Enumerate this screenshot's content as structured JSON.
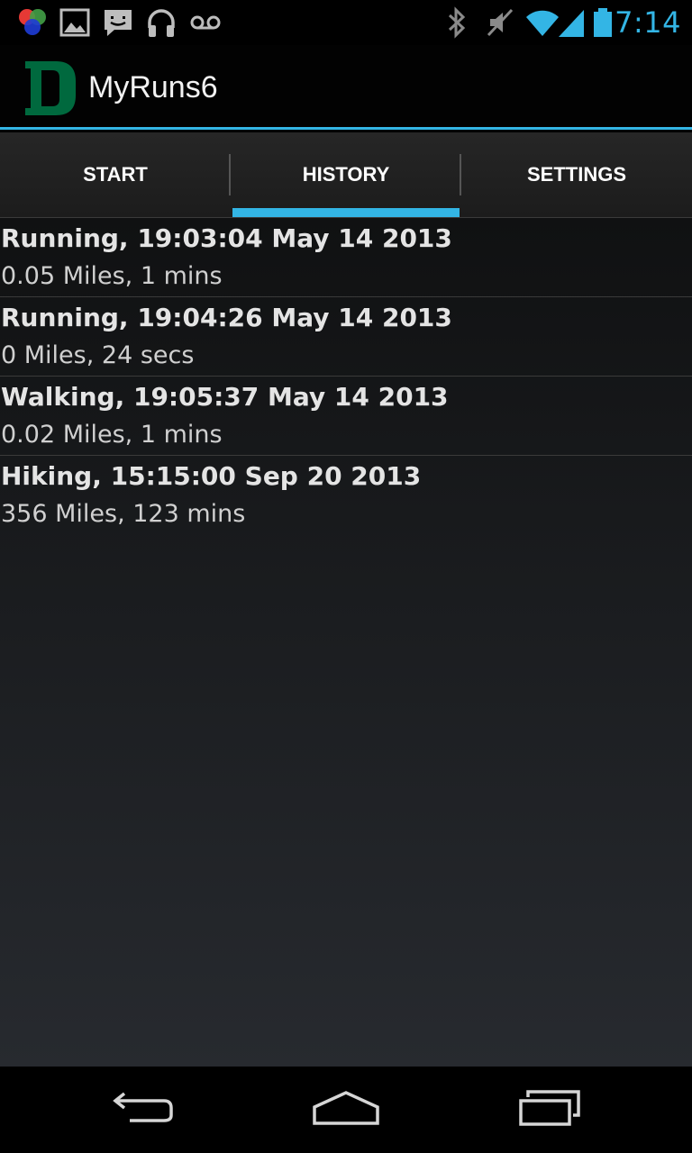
{
  "status_bar": {
    "time": "7:14",
    "accent_color": "#33b5e5",
    "left_icons": [
      "color-circles-icon",
      "gallery-icon",
      "message-icon",
      "headphones-icon",
      "voicemail-icon"
    ],
    "right_icons": [
      "bluetooth-icon",
      "vibrate-off-icon",
      "wifi-icon",
      "signal-icon",
      "battery-icon"
    ]
  },
  "action_bar": {
    "title": "MyRuns6",
    "logo_letter": "D",
    "logo_color": "#00693e"
  },
  "tabs": [
    {
      "label": "START",
      "selected": false
    },
    {
      "label": "HISTORY",
      "selected": true
    },
    {
      "label": "SETTINGS",
      "selected": false
    }
  ],
  "history": {
    "entries": [
      {
        "title": "Running, 19:03:04 May 14 2013",
        "detail": "0.05 Miles, 1 mins"
      },
      {
        "title": "Running, 19:04:26 May 14 2013",
        "detail": "0 Miles, 24 secs"
      },
      {
        "title": "Walking, 19:05:37 May 14 2013",
        "detail": "0.02 Miles, 1 mins"
      },
      {
        "title": "Hiking, 15:15:00 Sep 20 2013",
        "detail": "356 Miles, 123 mins"
      }
    ]
  },
  "nav_bar": {
    "icons": [
      "back-icon",
      "home-icon",
      "recent-apps-icon"
    ]
  }
}
